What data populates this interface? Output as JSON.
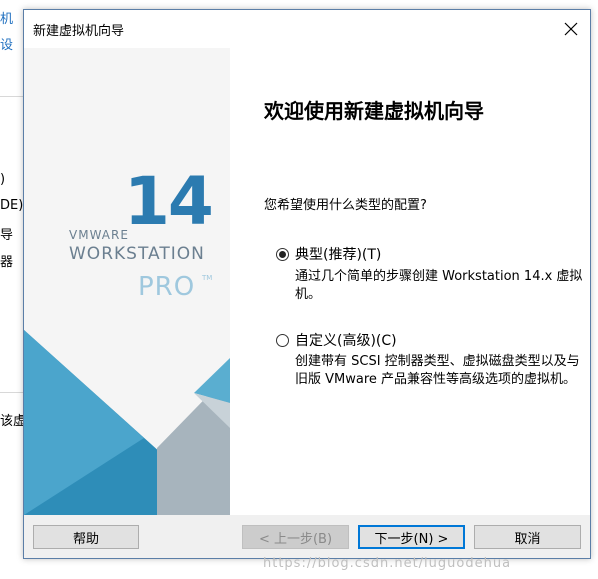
{
  "background_app": {
    "fragments": [
      "机",
      "设",
      ")",
      "DE)",
      "导",
      "器",
      "该虚"
    ]
  },
  "dialog": {
    "title": "新建虚拟机向导",
    "close_glyph": "✕",
    "logo": {
      "vmware": "VMWARE",
      "version": "14",
      "workstation": "WORKSTATION",
      "pro": "PRO",
      "tm": "TM"
    },
    "heading": "欢迎使用新建虚拟机向导",
    "question": "您希望使用什么类型的配置?",
    "options": [
      {
        "label": "典型(推荐)(T)",
        "description": "通过几个简单的步骤创建 Workstation 14.x 虚拟机。",
        "checked": true
      },
      {
        "label": "自定义(高级)(C)",
        "description": "创建带有 SCSI 控制器类型、虚拟磁盘类型以及与旧版 VMware 产品兼容性等高级选项的虚拟机。",
        "checked": false
      }
    ],
    "buttons": {
      "help": "帮助",
      "back": "< 上一步(B)",
      "next": "下一步(N) >",
      "cancel": "取消"
    }
  },
  "watermark": "https://blog.csdn.net/luguodehua",
  "colors": {
    "accent_dark": "#2e8db8",
    "accent_light": "#5aaed0",
    "gray_shape": "#a7b4bd",
    "logo_blue": "#2c7bb0",
    "dialog_border": "#5b7ea7"
  }
}
